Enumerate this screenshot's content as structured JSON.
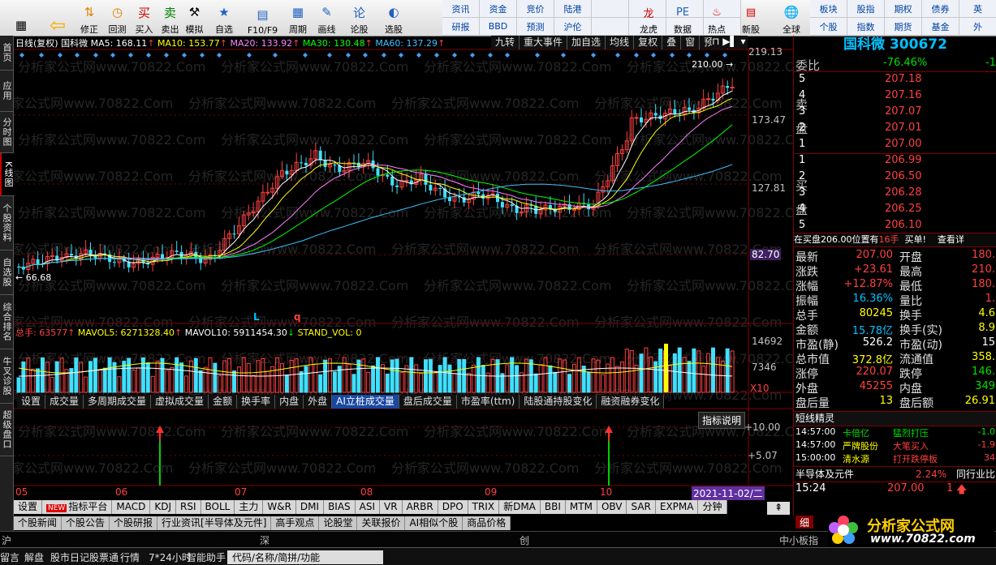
{
  "toolbar": {
    "buttons": [
      {
        "label": "",
        "icon": "grid-icon"
      },
      {
        "label": "",
        "icon": "back-arrow-icon"
      },
      {
        "label": "修正",
        "icon": "up-down-arrow-icon"
      },
      {
        "label": "回测",
        "icon": "clock-icon"
      },
      {
        "label": "买入",
        "icon": "buy-icon",
        "glyph": "买"
      },
      {
        "label": "卖出",
        "icon": "sell-icon",
        "glyph": "卖"
      },
      {
        "label": "模拟",
        "icon": "hammer-icon"
      },
      {
        "label": "自选",
        "icon": "star-icon"
      },
      {
        "label": "F10/F9",
        "icon": "f10-icon"
      },
      {
        "label": "周期",
        "icon": "period-icon"
      },
      {
        "label": "画线",
        "icon": "pencil-icon"
      },
      {
        "label": "论股",
        "icon": "discuss-icon"
      },
      {
        "label": "选股",
        "icon": "pick-stock-icon"
      }
    ],
    "grid": [
      "资讯",
      "资金",
      "竞价",
      "陆港",
      "",
      "",
      "",
      "",
      "研报",
      "BBD",
      "预测",
      "沪伦",
      "",
      "",
      "",
      ""
    ],
    "grid2": [
      {
        "label": "龙虎",
        "icon": "dragon-icon"
      },
      {
        "label": "数据",
        "icon": "pe-icon"
      },
      {
        "label": "热点",
        "icon": "hot-icon"
      },
      {
        "label": "新股",
        "icon": "new-stock-icon"
      }
    ],
    "global": {
      "label": "全球",
      "icon": "globe-icon"
    },
    "grid3": [
      "板块",
      "股指",
      "期权",
      "债券",
      "英",
      "个股",
      "指数",
      "期货",
      "基金",
      "外"
    ]
  },
  "leftnav": [
    {
      "label": "首页",
      "h": 42
    },
    {
      "label": "应用",
      "h": 50
    },
    {
      "label": "分时图",
      "h": 50
    },
    {
      "label": "K线图",
      "h": 52,
      "active": true
    },
    {
      "label": "个股资料",
      "h": 66
    },
    {
      "label": "自选股",
      "h": 54
    },
    {
      "label": "综合排名",
      "h": 66
    },
    {
      "label": "牛叉诊股",
      "h": 66
    },
    {
      "label": "超级盘口",
      "h": 64
    }
  ],
  "chart": {
    "header": {
      "period": "日线(复权)",
      "stock": "国科微",
      "ma5": "MA5: 168.11",
      "ma10": "MA10: 153.77",
      "ma20": "MA20: 133.92",
      "ma30": "MA30: 130.48",
      "ma60": "MA60: 137.29"
    },
    "header_buttons": [
      "九转",
      "重大事件",
      "加自选",
      "均线",
      "复权",
      "叠",
      "窗",
      "预测"
    ],
    "price_axis": [
      "219.13",
      "173.47",
      "127.81",
      "82.70"
    ],
    "price_marks": {
      "high": "210.00",
      "low": "66.68",
      "high_label": "L",
      "low_label": "q"
    },
    "volume_header": {
      "total": "总手: 63577",
      "mavol5": "MAVOL5: 6271328.40",
      "mavol10": "MAVOL10: 5911454.30",
      "std": "STAND_VOL: 0"
    },
    "volume_axis": [
      "14692",
      "7346",
      "X10"
    ],
    "indicator_tabs": [
      "设置",
      "成交量",
      "多周期成交量",
      "虚拟成交量",
      "金额",
      "换手率",
      "内盘",
      "外盘",
      "AI立桩成交量",
      "盘后成交量",
      "市盈率(ttm)",
      "陆股通持股变化",
      "融资融券变化"
    ],
    "indicator_selected": "AI立桩成交量",
    "indicator_button": "指标说明",
    "indicator_axis": [
      "+10.00",
      "+5.07"
    ],
    "months": [
      "05",
      "06",
      "07",
      "08",
      "09",
      "10"
    ],
    "date_label": "2021-11-02/二",
    "watermark": "分析家公式网www.70822.Com"
  },
  "bottom_tabs": [
    "设置",
    "指标平台",
    "MACD",
    "KDJ",
    "RSI",
    "BOLL",
    "主力",
    "W&R",
    "DMI",
    "BIAS",
    "ASI",
    "VR",
    "ARBR",
    "DPO",
    "TRIX",
    "新DMA",
    "BBI",
    "MTM",
    "OBV",
    "SAR",
    "EXPMA",
    "分钟"
  ],
  "bottom_new_badge": "NEW",
  "news_tabs": [
    "个股新闻",
    "个股公告",
    "个股研报",
    "行业资讯[半导体及元件]",
    "高手观点",
    "论股堂",
    "关联报价",
    "AI相似个股",
    "商品价格"
  ],
  "markets": [
    "沪",
    "深",
    "创",
    "中小板指"
  ],
  "status": [
    "留言",
    "解盘",
    "股市日记",
    "股票通",
    "行情",
    "7*24小时",
    "智能助手",
    "代码/名称/简拼/功能"
  ],
  "right": {
    "title": "国科微 300672",
    "weibi_label": "委比",
    "weibi": "-76.46%",
    "weicha": "-1",
    "sell_label": "卖盘",
    "buy_label": "买盘",
    "asks": [
      {
        "n": "5",
        "p": "207.18"
      },
      {
        "n": "4",
        "p": "207.16"
      },
      {
        "n": "3",
        "p": "207.07"
      },
      {
        "n": "2",
        "p": "207.01"
      },
      {
        "n": "1",
        "p": "207.00"
      }
    ],
    "bids": [
      {
        "n": "1",
        "p": "206.99"
      },
      {
        "n": "2",
        "p": "206.50"
      },
      {
        "n": "3",
        "p": "206.28"
      },
      {
        "n": "4",
        "p": "206.25"
      },
      {
        "n": "5",
        "p": "206.10"
      }
    ],
    "notice": "在买盘206.00位置有",
    "notice_qty": "16手",
    "notice_tail": "买单!",
    "notice_link": "查看详",
    "stats": [
      {
        "l": "最新",
        "v": "207.00",
        "c": "red",
        "l2": "开盘",
        "v2": "180.",
        "c2": "red"
      },
      {
        "l": "涨跌",
        "v": "+23.61",
        "c": "red",
        "l2": "最高",
        "v2": "210.",
        "c2": "red"
      },
      {
        "l": "涨幅",
        "v": "+12.87%",
        "c": "red",
        "l2": "最低",
        "v2": "180.",
        "c2": "red"
      },
      {
        "l": "振幅",
        "v": "16.36%",
        "c": "cyan",
        "l2": "量比",
        "v2": "1.",
        "c2": "red"
      },
      {
        "l": "总手",
        "v": "80245",
        "c": "yellow",
        "l2": "换手",
        "v2": "4.6",
        "c2": "yellow"
      },
      {
        "l": "金额",
        "v": "15.78亿",
        "c": "cyan",
        "l2": "换手(实)",
        "v2": "8.9",
        "c2": "yellow"
      },
      {
        "l": "市盈(静)",
        "v": "526.2",
        "c": "white",
        "l2": "市盈(动)",
        "v2": "15",
        "c2": "white"
      },
      {
        "l": "总市值",
        "v": "372.8亿",
        "c": "yellow",
        "l2": "流通值",
        "v2": "358.",
        "c2": "yellow"
      },
      {
        "l": "涨停",
        "v": "220.07",
        "c": "red",
        "l2": "跌停",
        "v2": "146.",
        "c2": "green"
      },
      {
        "l": "外盘",
        "v": "45255",
        "c": "red",
        "l2": "内盘",
        "v2": "349",
        "c2": "green"
      },
      {
        "l": "盘后量",
        "v": "13",
        "c": "yellow",
        "l2": "盘后额",
        "v2": "26.91",
        "c2": "yellow"
      }
    ],
    "short_title": "短线精灵",
    "short": [
      {
        "t": "14:57:00",
        "s": "卡倍亿",
        "e": "猛烈打压",
        "v": "-1.0",
        "sc": "green",
        "ec": "green",
        "vc": "green"
      },
      {
        "t": "14:57:00",
        "s": "严牌股份",
        "e": "大笔买入",
        "v": "-1.9",
        "sc": "yellow",
        "ec": "red",
        "vc": "red"
      },
      {
        "t": "15:00:00",
        "s": "清水源",
        "e": "打开跌停板",
        "v": "34",
        "sc": "yellow",
        "ec": "red",
        "vc": "red"
      }
    ],
    "sector": "半导体及元件",
    "sector_pct": "2.24%",
    "sector_link": "同行业比",
    "tick_time": "15:24",
    "tick_price": "207.00",
    "tick_qty": "1",
    "detail_tab": "细",
    "logo": "分析家公式网",
    "logo_url": "www.70822.com"
  }
}
